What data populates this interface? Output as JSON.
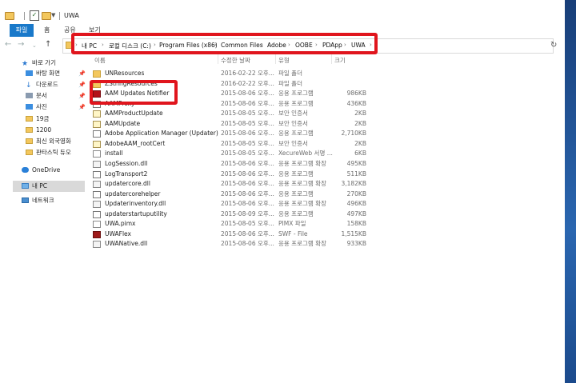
{
  "window": {
    "title": "UWA",
    "qa_arrow": "▼",
    "qa_check": "✓"
  },
  "ribbon": {
    "file_tab": "파일",
    "tabs": [
      "홈",
      "공유",
      "보기"
    ]
  },
  "nav": {
    "back": "←",
    "forward": "→",
    "up": "↑",
    "refresh": "↻"
  },
  "address": {
    "separator": "›",
    "crumbs": [
      "내 PC",
      "로컬 디스크 (C:)",
      "Program Files (x86)",
      "Common Files",
      "Adobe",
      "OOBE",
      "PDApp",
      "UWA"
    ]
  },
  "sidebar": {
    "quick_access": "바로 가기",
    "items": [
      {
        "label": "바탕 화면",
        "icon": "desktop-icon",
        "pinned": true
      },
      {
        "label": "다운로드",
        "icon": "download-icon",
        "pinned": true
      },
      {
        "label": "문서",
        "icon": "documents-icon",
        "pinned": true
      },
      {
        "label": "사진",
        "icon": "pictures-icon",
        "pinned": true
      },
      {
        "label": "19금",
        "icon": "folder-icon",
        "pinned": false
      },
      {
        "label": "1200",
        "icon": "folder-icon",
        "pinned": false
      },
      {
        "label": "최신 외국영화",
        "icon": "folder-icon",
        "pinned": false
      },
      {
        "label": "판타스틱 듀오",
        "icon": "folder-icon",
        "pinned": false
      }
    ],
    "onedrive": "OneDrive",
    "this_pc": "내 PC",
    "network": "네트워크",
    "pin_glyph": "📌"
  },
  "columns": {
    "name": "이름",
    "date": "수정한 날짜",
    "type": "유형",
    "size": "크기"
  },
  "files": [
    {
      "name": "UNResources",
      "date": "2016-02-22 오후...",
      "type": "파일 폴더",
      "size": "",
      "icon": "folder"
    },
    {
      "name": "ZStringResources",
      "date": "2016-02-22 오후...",
      "type": "파일 폴더",
      "size": "",
      "icon": "folder"
    },
    {
      "name": "AAM Updates Notifier",
      "date": "2015-08-06 오후...",
      "type": "응용 프로그램",
      "size": "986KB",
      "icon": "appred"
    },
    {
      "name": "AAMProxy",
      "date": "2015-08-06 오후...",
      "type": "응용 프로그램",
      "size": "436KB",
      "icon": "app"
    },
    {
      "name": "AAMProductUpdate",
      "date": "2015-08-05 오후...",
      "type": "보안 인증서",
      "size": "2KB",
      "icon": "cert"
    },
    {
      "name": "AAMUpdate",
      "date": "2015-08-05 오후...",
      "type": "보안 인증서",
      "size": "2KB",
      "icon": "cert"
    },
    {
      "name": "Adobe Application Manager (Updater)",
      "date": "2015-08-06 오후...",
      "type": "응용 프로그램",
      "size": "2,710KB",
      "icon": "app"
    },
    {
      "name": "AdobeAAM_rootCert",
      "date": "2015-08-05 오후...",
      "type": "보안 인증서",
      "size": "2KB",
      "icon": "cert"
    },
    {
      "name": "install",
      "date": "2015-08-05 오후...",
      "type": "XecureWeb 서명 ...",
      "size": "6KB",
      "icon": "doc"
    },
    {
      "name": "LogSession.dll",
      "date": "2015-08-06 오후...",
      "type": "응용 프로그램 확장",
      "size": "495KB",
      "icon": "dll"
    },
    {
      "name": "LogTransport2",
      "date": "2015-08-06 오후...",
      "type": "응용 프로그램",
      "size": "511KB",
      "icon": "app"
    },
    {
      "name": "updatercore.dll",
      "date": "2015-08-06 오후...",
      "type": "응용 프로그램 확장",
      "size": "3,182KB",
      "icon": "dll"
    },
    {
      "name": "updatercorehelper",
      "date": "2015-08-06 오후...",
      "type": "응용 프로그램",
      "size": "270KB",
      "icon": "app"
    },
    {
      "name": "Updaterinventory.dll",
      "date": "2015-08-06 오후...",
      "type": "응용 프로그램 확장",
      "size": "496KB",
      "icon": "dll"
    },
    {
      "name": "updaterstartuputility",
      "date": "2015-08-09 오후...",
      "type": "응용 프로그램",
      "size": "497KB",
      "icon": "app"
    },
    {
      "name": "UWA.pimx",
      "date": "2015-08-05 오후...",
      "type": "PIMX 파일",
      "size": "158KB",
      "icon": "doc"
    },
    {
      "name": "UWAFlex",
      "date": "2015-08-06 오후...",
      "type": "SWF - File",
      "size": "1,515KB",
      "icon": "swf"
    },
    {
      "name": "UWANative.dll",
      "date": "2015-08-06 오후...",
      "type": "응용 프로그램 확장",
      "size": "933KB",
      "icon": "dll"
    }
  ],
  "colors": {
    "file_tab": "#1979ca",
    "highlight_box": "#e0151d",
    "folder": "#f3c75d",
    "selection": "#d9d9d9"
  }
}
